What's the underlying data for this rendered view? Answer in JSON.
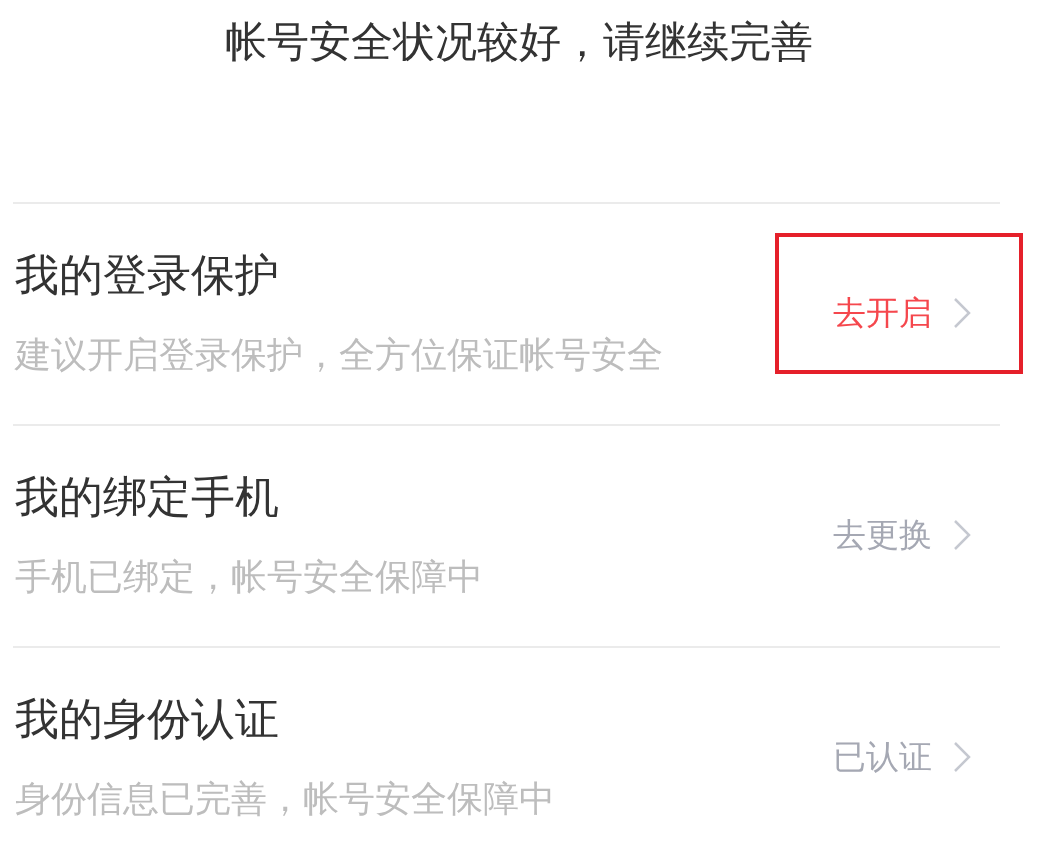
{
  "header": {
    "title": "帐号安全状况较好，请继续完善"
  },
  "items": [
    {
      "title": "我的登录保护",
      "description": "建议开启登录保护，全方位保证帐号安全",
      "action": {
        "label": "去开启",
        "alert": true
      },
      "highlighted": true
    },
    {
      "title": "我的绑定手机",
      "description": "手机已绑定，帐号安全保障中",
      "action": {
        "label": "去更换",
        "alert": false
      },
      "highlighted": false
    },
    {
      "title": "我的身份认证",
      "description": "身份信息已完善，帐号安全保障中",
      "action": {
        "label": "已认证",
        "alert": false
      },
      "highlighted": false
    }
  ]
}
